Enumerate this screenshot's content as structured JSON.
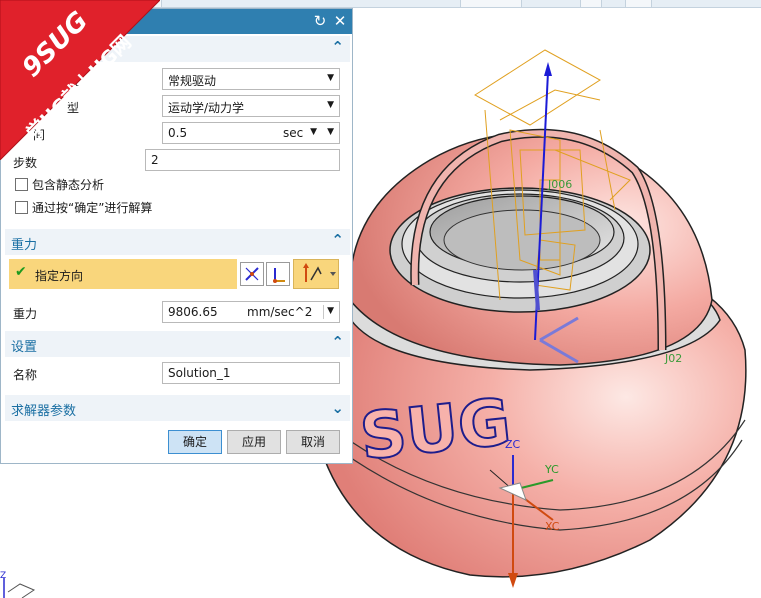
{
  "watermark": {
    "line1": "9SUG",
    "line2": "学UG就上UG网",
    "color": "#e0212b"
  },
  "dialog": {
    "title_icons": {
      "reset": "reset-icon",
      "close": "close-icon"
    },
    "section1": {
      "rows": [
        {
          "label": "置",
          "value": "常规驱动"
        },
        {
          "label": "型",
          "value": "运动学/动力学"
        }
      ],
      "time": {
        "label": "间",
        "value": "0.5",
        "unit": "sec"
      },
      "steps": {
        "label": "步数",
        "value": "2"
      },
      "static_check": "包含静态分析",
      "confirm_check": "通过按“确定”进行解算"
    },
    "gravity": {
      "title": "重力",
      "direction_label": "指定方向",
      "gravity_label": "重力",
      "gravity_value": "9806.65",
      "gravity_unit": "mm/sec^2"
    },
    "settings": {
      "title": "设置",
      "name_label": "名称",
      "name_value": "Solution_1"
    },
    "solver": {
      "title": "求解器参数"
    },
    "buttons": {
      "ok": "确定",
      "apply": "应用",
      "cancel": "取消"
    }
  },
  "scene": {
    "model_text": "SUG",
    "axis_labels": {
      "zc": "ZC",
      "yc": "YC",
      "xc": "XC"
    },
    "joint_label_a": "J006",
    "joint_label_b": "J02",
    "corner_axis": "Z",
    "colors": {
      "shell": "#f2a19a",
      "outline": "#222222",
      "wire": "#e0a020",
      "accent": "#2f7fb0"
    }
  }
}
